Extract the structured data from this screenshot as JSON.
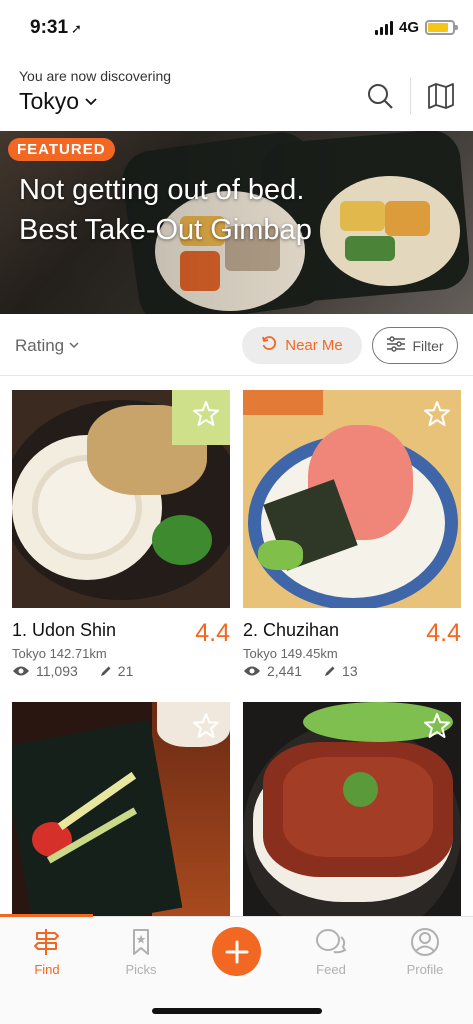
{
  "status_bar": {
    "time": "9:31",
    "network": "4G"
  },
  "header": {
    "discover_label": "You are now discovering",
    "city": "Tokyo"
  },
  "featured": {
    "badge": "FEATURED",
    "line1": "Not getting out of bed.",
    "line2": "Best Take-Out Gimbap"
  },
  "filters": {
    "sort_label": "Rating",
    "near_me_label": "Near Me",
    "filter_label": "Filter"
  },
  "restaurants": [
    {
      "title": "1. Udon Shin",
      "score": "4.4",
      "distance": "Tokyo 142.71km",
      "views": "11,093",
      "edits": "21"
    },
    {
      "title": "2. Chuzihan",
      "score": "4.4",
      "distance": "Tokyo 149.45km",
      "views": "2,441",
      "edits": "13"
    },
    {
      "title": "",
      "score": "",
      "distance": "",
      "views": "",
      "edits": ""
    },
    {
      "title": "",
      "score": "",
      "distance": "",
      "views": "",
      "edits": ""
    }
  ],
  "tabs": [
    {
      "label": "Find",
      "icon": "signpost-icon",
      "active": true
    },
    {
      "label": "Picks",
      "icon": "bookmark-icon",
      "active": false
    },
    {
      "label": "",
      "icon": "plus-icon",
      "active": false
    },
    {
      "label": "Feed",
      "icon": "chat-bubbles-icon",
      "active": false
    },
    {
      "label": "Profile",
      "icon": "person-icon",
      "active": false
    }
  ],
  "colors": {
    "accent": "#f26822",
    "battery": "#f5c518",
    "inactive": "#b0b0b0"
  }
}
